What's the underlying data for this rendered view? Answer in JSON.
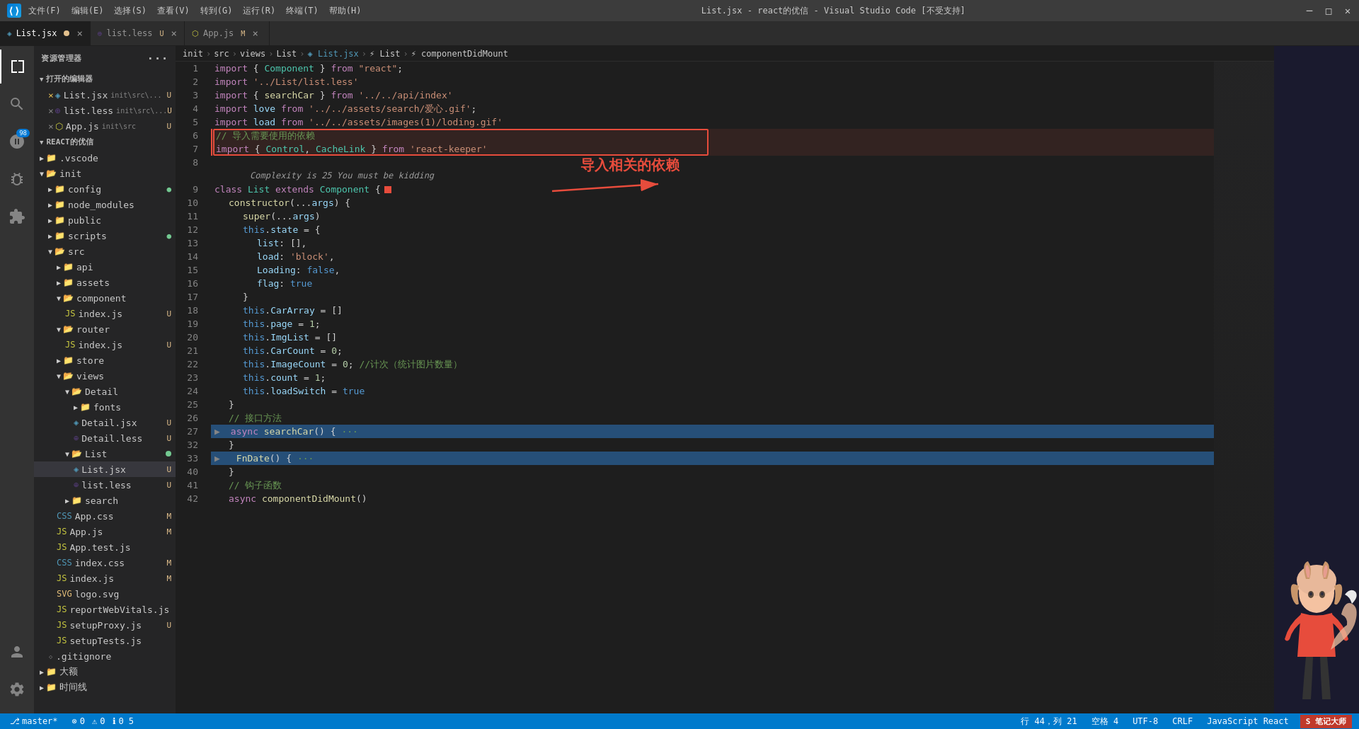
{
  "titleBar": {
    "title": "List.jsx - react的优信 - Visual Studio Code [不受支持]",
    "menus": [
      "文件(F)",
      "编辑(E)",
      "选择(S)",
      "查看(V)",
      "转到(G)",
      "运行(R)",
      "终端(T)",
      "帮助(H)"
    ],
    "windowControls": [
      "—",
      "□",
      "✕"
    ]
  },
  "tabs": [
    {
      "label": "List.jsx",
      "icon": "jsx",
      "active": true,
      "modified": false,
      "close": "×",
      "pinned": false
    },
    {
      "label": "list.less",
      "icon": "less",
      "active": false,
      "modified": false,
      "close": "U",
      "pinned": false
    },
    {
      "label": "App.js",
      "icon": "js",
      "active": false,
      "modified": false,
      "close": "M",
      "pinned": false
    }
  ],
  "breadcrumb": [
    "init",
    "src",
    "views",
    "List",
    "List.jsx",
    "List",
    "componentDidMount"
  ],
  "sidebar": {
    "title": "资源管理器",
    "openEditors": "打开的编辑器",
    "openFiles": [
      {
        "name": "List.jsx",
        "path": "init\\src\\...",
        "badge": "U"
      },
      {
        "name": "list.less",
        "path": "init\\src\\...",
        "badge": "U"
      },
      {
        "name": "App.js",
        "path": "init\\src",
        "badge": "U"
      }
    ],
    "project": "REACT的优信",
    "tree": [
      {
        "label": ".vscode",
        "type": "folder",
        "indent": 1,
        "open": false
      },
      {
        "label": "init",
        "type": "folder",
        "indent": 1,
        "open": true
      },
      {
        "label": "config",
        "type": "folder",
        "indent": 2,
        "open": false,
        "badge": "●"
      },
      {
        "label": "node_modules",
        "type": "folder",
        "indent": 2,
        "open": false
      },
      {
        "label": "public",
        "type": "folder",
        "indent": 2,
        "open": false
      },
      {
        "label": "scripts",
        "type": "folder",
        "indent": 2,
        "open": false,
        "badge": "●"
      },
      {
        "label": "src",
        "type": "folder",
        "indent": 2,
        "open": true
      },
      {
        "label": "api",
        "type": "folder",
        "indent": 3,
        "open": false
      },
      {
        "label": "assets",
        "type": "folder",
        "indent": 3,
        "open": false
      },
      {
        "label": "component",
        "type": "folder",
        "indent": 3,
        "open": true
      },
      {
        "label": "index.js",
        "type": "file-js",
        "indent": 4,
        "badge": "U"
      },
      {
        "label": "router",
        "type": "folder",
        "indent": 3,
        "open": true
      },
      {
        "label": "index.js",
        "type": "file-js",
        "indent": 4,
        "badge": "U"
      },
      {
        "label": "store",
        "type": "folder",
        "indent": 3,
        "open": false
      },
      {
        "label": "views",
        "type": "folder",
        "indent": 3,
        "open": true
      },
      {
        "label": "Detail",
        "type": "folder",
        "indent": 4,
        "open": true
      },
      {
        "label": "fonts",
        "type": "folder",
        "indent": 5,
        "open": false
      },
      {
        "label": "Detail.jsx",
        "type": "file-jsx",
        "indent": 5,
        "badge": "U"
      },
      {
        "label": "Detail.less",
        "type": "file-less",
        "indent": 5,
        "badge": "U"
      },
      {
        "label": "List",
        "type": "folder",
        "indent": 4,
        "open": true
      },
      {
        "label": "List.jsx",
        "type": "file-jsx",
        "indent": 5,
        "badge": "U",
        "active": true
      },
      {
        "label": "list.less",
        "type": "file-less",
        "indent": 5,
        "badge": "U"
      },
      {
        "label": "search",
        "type": "folder",
        "indent": 4,
        "open": false
      },
      {
        "label": "App.css",
        "type": "file-css",
        "indent": 3,
        "badge": "M"
      },
      {
        "label": "App.js",
        "type": "file-js",
        "indent": 3,
        "badge": "M"
      },
      {
        "label": "App.test.js",
        "type": "file-js",
        "indent": 3
      },
      {
        "label": "index.css",
        "type": "file-css",
        "indent": 3,
        "badge": "M"
      },
      {
        "label": "index.js",
        "type": "file-js",
        "indent": 3,
        "badge": "M"
      },
      {
        "label": "logo.svg",
        "type": "file-svg",
        "indent": 3
      },
      {
        "label": "reportWebVitals.js",
        "type": "file-js",
        "indent": 3
      },
      {
        "label": "setupProxy.js",
        "type": "file-js",
        "indent": 3,
        "badge": "U"
      },
      {
        "label": "setupTests.js",
        "type": "file-js",
        "indent": 3
      },
      {
        "label": ".gitignore",
        "type": "file",
        "indent": 2
      },
      {
        "label": "大额",
        "type": "folder",
        "indent": 1,
        "open": false
      },
      {
        "label": "时间线",
        "type": "folder",
        "indent": 1,
        "open": false
      }
    ]
  },
  "code": {
    "lines": [
      {
        "num": 1,
        "tokens": [
          {
            "t": "import",
            "c": "kw"
          },
          {
            "t": " { ",
            "c": "op"
          },
          {
            "t": "Component",
            "c": "type"
          },
          {
            "t": " } ",
            "c": "op"
          },
          {
            "t": "from",
            "c": "kw"
          },
          {
            "t": " ",
            "c": ""
          },
          {
            "t": "\"react\"",
            "c": "str"
          },
          {
            "t": ";",
            "c": "punc"
          }
        ]
      },
      {
        "num": 2,
        "tokens": [
          {
            "t": "import",
            "c": "kw"
          },
          {
            "t": " ",
            "c": ""
          },
          {
            "t": "'../List/list.less'",
            "c": "str"
          },
          {
            "t": "",
            "c": ""
          }
        ]
      },
      {
        "num": 3,
        "tokens": [
          {
            "t": "import",
            "c": "kw"
          },
          {
            "t": " { ",
            "c": "op"
          },
          {
            "t": "searchCar",
            "c": "fn"
          },
          {
            "t": " } ",
            "c": "op"
          },
          {
            "t": "from",
            "c": "kw"
          },
          {
            "t": " ",
            "c": ""
          },
          {
            "t": "'../../api/index'",
            "c": "str"
          }
        ]
      },
      {
        "num": 4,
        "tokens": [
          {
            "t": "import",
            "c": "kw"
          },
          {
            "t": " ",
            "c": ""
          },
          {
            "t": "love",
            "c": "var"
          },
          {
            "t": " ",
            "c": ""
          },
          {
            "t": "from",
            "c": "kw"
          },
          {
            "t": " ",
            "c": ""
          },
          {
            "t": "'../../assets/search/爱心.gif'",
            "c": "str"
          },
          {
            "t": ";",
            "c": "punc"
          }
        ]
      },
      {
        "num": 5,
        "tokens": [
          {
            "t": "import",
            "c": "kw"
          },
          {
            "t": " ",
            "c": ""
          },
          {
            "t": "load",
            "c": "var"
          },
          {
            "t": " ",
            "c": ""
          },
          {
            "t": "from",
            "c": "kw"
          },
          {
            "t": " ",
            "c": ""
          },
          {
            "t": "'../../assets/images(1)/loding.gif'",
            "c": "str"
          }
        ]
      },
      {
        "num": 6,
        "tokens": [
          {
            "t": "// 导入需要使用的依赖",
            "c": "comment"
          }
        ],
        "annotated": true
      },
      {
        "num": 7,
        "tokens": [
          {
            "t": "import",
            "c": "kw"
          },
          {
            "t": " { ",
            "c": "op"
          },
          {
            "t": "Control",
            "c": "type"
          },
          {
            "t": ", ",
            "c": "punc"
          },
          {
            "t": "CacheLink",
            "c": "type"
          },
          {
            "t": " } ",
            "c": "op"
          },
          {
            "t": "from",
            "c": "kw"
          },
          {
            "t": " ",
            "c": ""
          },
          {
            "t": "'react-keeper'",
            "c": "str"
          }
        ],
        "annotated": true
      },
      {
        "num": 8,
        "tokens": []
      },
      {
        "num": null,
        "complexity": "Complexity is 25 You must be kidding"
      },
      {
        "num": 9,
        "tokens": [
          {
            "t": "class",
            "c": "kw"
          },
          {
            "t": " ",
            "c": ""
          },
          {
            "t": "List",
            "c": "type"
          },
          {
            "t": " ",
            "c": ""
          },
          {
            "t": "extends",
            "c": "kw"
          },
          {
            "t": " ",
            "c": ""
          },
          {
            "t": "Component",
            "c": "type"
          },
          {
            "t": " {",
            "c": "punc"
          }
        ],
        "errorSquare": true
      },
      {
        "num": 10,
        "tokens": [
          {
            "t": "    constructor",
            "c": "fn"
          },
          {
            "t": "(...",
            "c": "punc"
          },
          {
            "t": "args",
            "c": "var"
          },
          {
            "t": ") {",
            "c": "punc"
          }
        ]
      },
      {
        "num": 11,
        "tokens": [
          {
            "t": "        super",
            "c": "fn"
          },
          {
            "t": "(...",
            "c": "punc"
          },
          {
            "t": "args",
            "c": "var"
          },
          {
            "t": "  )",
            "c": "punc"
          }
        ]
      },
      {
        "num": 12,
        "tokens": [
          {
            "t": "        this",
            "c": "kw2"
          },
          {
            "t": ".",
            "c": "punc"
          },
          {
            "t": "state",
            "c": "prop"
          },
          {
            "t": " = {",
            "c": "op"
          }
        ]
      },
      {
        "num": 13,
        "tokens": [
          {
            "t": "            list",
            "c": "prop"
          },
          {
            "t": ": [],",
            "c": "op"
          }
        ]
      },
      {
        "num": 14,
        "tokens": [
          {
            "t": "            load",
            "c": "prop"
          },
          {
            "t": ": ",
            "c": "op"
          },
          {
            "t": "'block'",
            "c": "str"
          },
          {
            "t": ",",
            "c": "punc"
          }
        ]
      },
      {
        "num": 15,
        "tokens": [
          {
            "t": "            Loading",
            "c": "prop"
          },
          {
            "t": ": ",
            "c": "op"
          },
          {
            "t": "false",
            "c": "kw2"
          },
          {
            "t": ",",
            "c": "punc"
          }
        ]
      },
      {
        "num": 16,
        "tokens": [
          {
            "t": "            flag",
            "c": "prop"
          },
          {
            "t": ": ",
            "c": "op"
          },
          {
            "t": "true",
            "c": "kw2"
          }
        ]
      },
      {
        "num": 17,
        "tokens": [
          {
            "t": "        }",
            "c": "punc"
          }
        ]
      },
      {
        "num": 18,
        "tokens": [
          {
            "t": "        this",
            "c": "kw2"
          },
          {
            "t": ".",
            "c": "punc"
          },
          {
            "t": "CarArray",
            "c": "prop"
          },
          {
            "t": " = []",
            "c": "op"
          }
        ]
      },
      {
        "num": 19,
        "tokens": [
          {
            "t": "        this",
            "c": "kw2"
          },
          {
            "t": ".",
            "c": "punc"
          },
          {
            "t": "page",
            "c": "prop"
          },
          {
            "t": " = ",
            "c": "op"
          },
          {
            "t": "1",
            "c": "num"
          },
          {
            "t": ";",
            "c": "punc"
          }
        ]
      },
      {
        "num": 20,
        "tokens": [
          {
            "t": "        this",
            "c": "kw2"
          },
          {
            "t": ".",
            "c": "punc"
          },
          {
            "t": "ImgList",
            "c": "prop"
          },
          {
            "t": " = []",
            "c": "op"
          }
        ]
      },
      {
        "num": 21,
        "tokens": [
          {
            "t": "        this",
            "c": "kw2"
          },
          {
            "t": ".",
            "c": "punc"
          },
          {
            "t": "CarCount",
            "c": "prop"
          },
          {
            "t": " = ",
            "c": "op"
          },
          {
            "t": "0",
            "c": "num"
          },
          {
            "t": ";",
            "c": "punc"
          }
        ]
      },
      {
        "num": 22,
        "tokens": [
          {
            "t": "        this",
            "c": "kw2"
          },
          {
            "t": ".",
            "c": "punc"
          },
          {
            "t": "ImageCount",
            "c": "prop"
          },
          {
            "t": " = ",
            "c": "op"
          },
          {
            "t": "0",
            "c": "num"
          },
          {
            "t": "; ",
            "c": "punc"
          },
          {
            "t": "//计次（统计图片数量）",
            "c": "comment"
          }
        ]
      },
      {
        "num": 23,
        "tokens": [
          {
            "t": "        this",
            "c": "kw2"
          },
          {
            "t": ".",
            "c": "punc"
          },
          {
            "t": "count",
            "c": "prop"
          },
          {
            "t": " = ",
            "c": "op"
          },
          {
            "t": "1",
            "c": "num"
          },
          {
            "t": ";",
            "c": "punc"
          }
        ]
      },
      {
        "num": 24,
        "tokens": [
          {
            "t": "        this",
            "c": "kw2"
          },
          {
            "t": ".",
            "c": "punc"
          },
          {
            "t": "loadSwitch",
            "c": "prop"
          },
          {
            "t": " = ",
            "c": "op"
          },
          {
            "t": "true",
            "c": "kw2"
          }
        ]
      },
      {
        "num": 25,
        "tokens": [
          {
            "t": "    }",
            "c": "punc"
          }
        ]
      },
      {
        "num": 26,
        "tokens": [
          {
            "t": "    // 接口方法",
            "c": "comment"
          }
        ]
      },
      {
        "num": 27,
        "tokens": [
          {
            "t": "    async",
            "c": "kw"
          },
          {
            "t": " ",
            "c": ""
          },
          {
            "t": "searchCar",
            "c": "fn"
          },
          {
            "t": "() { ",
            "c": "punc"
          },
          {
            "t": "···",
            "c": "comment"
          }
        ],
        "folded": true,
        "highlighted": true
      },
      {
        "num": 32,
        "tokens": [
          {
            "t": "    }",
            "c": "punc"
          }
        ]
      },
      {
        "num": 33,
        "tokens": [
          {
            "t": "    ",
            "c": ""
          },
          {
            "t": "FnDate",
            "c": "fn"
          },
          {
            "t": "() { ",
            "c": "punc"
          },
          {
            "t": "···",
            "c": "comment"
          }
        ],
        "folded": true,
        "highlighted": true
      },
      {
        "num": 40,
        "tokens": [
          {
            "t": "    }",
            "c": "punc"
          }
        ]
      },
      {
        "num": 41,
        "tokens": [
          {
            "t": "    // 钩子函数",
            "c": "comment"
          }
        ]
      },
      {
        "num": 42,
        "tokens": [
          {
            "t": "    async componentDidMount",
            "c": "fn"
          },
          {
            "t": "() ",
            "c": "punc"
          }
        ],
        "partial": true
      }
    ]
  },
  "statusBar": {
    "branch": "master*",
    "errors": "0",
    "warnings": "0",
    "info": "0",
    "hints": "5",
    "position": "行 44，列 21",
    "spaces": "空格 4",
    "encoding": "UTF-8",
    "lineEnding": "CRLF",
    "language": "JavaScript React"
  },
  "annotation": {
    "text": "导入相关的依赖"
  }
}
